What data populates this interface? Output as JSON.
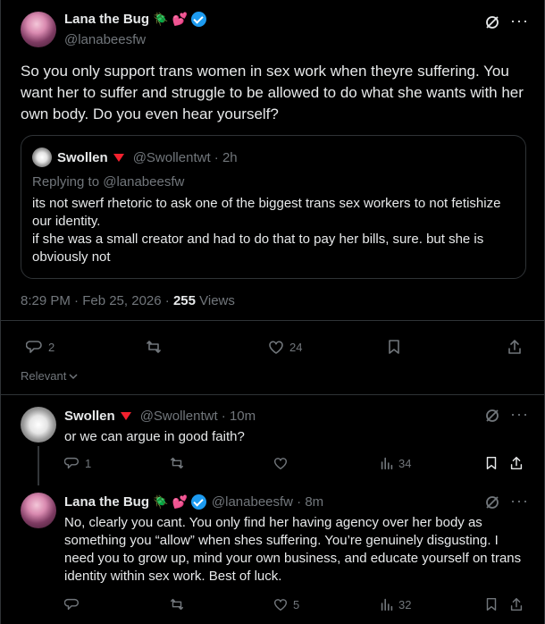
{
  "main_post": {
    "author": {
      "name": "Lana the Bug",
      "emoji_bug": "🪲",
      "emoji_hearts": "💕",
      "handle": "@lanabeesfw"
    },
    "text": "So you only support trans women in sex work when theyre suffering. You want her to suffer and struggle to be allowed to do what she wants with her own body. Do you even hear yourself?",
    "timestamp": "8:29 PM · Feb 25, 2026 · ",
    "views_count": "255",
    "views_label": " Views",
    "actions": {
      "replies": "2",
      "reposts": "",
      "likes": "24"
    }
  },
  "quoted_post": {
    "name": "Swollen",
    "handle": "@Swollentwt · 2h",
    "replying_to": "Replying to @lanabeesfw",
    "lines": [
      "its not swerf rhetoric to ask one of the biggest trans sex workers to not fetishize",
      "our identity.",
      "if she was a small creator and had to do that to pay her bills, sure. but she is",
      "obviously not"
    ]
  },
  "sort": {
    "label": "Relevant"
  },
  "replies": [
    {
      "name": "Swollen",
      "handle": "@Swollentwt · 10m",
      "text": "or we can argue in good faith?",
      "replies": "1",
      "views": "34"
    },
    {
      "name": "Lana the Bug",
      "emoji_bug": "🪲",
      "emoji_hearts": "💕",
      "handle": "@lanabeesfw · 8m",
      "lines": [
        "No, clearly you cant. You only find her having agency over her body as",
        "something you “allow” when shes suffering. You’re genuinely disgusting. I",
        "need you to grow up, mind your own business, and educate yourself on trans",
        "identity within sex work. Best of luck."
      ],
      "likes": "5",
      "views": "32"
    }
  ],
  "colors": {
    "bg": "#000000",
    "text": "#e7e9ea",
    "muted": "#71767b",
    "border": "#2f3336",
    "verified": "#1d9bf0",
    "triangle": "#f4212e"
  }
}
